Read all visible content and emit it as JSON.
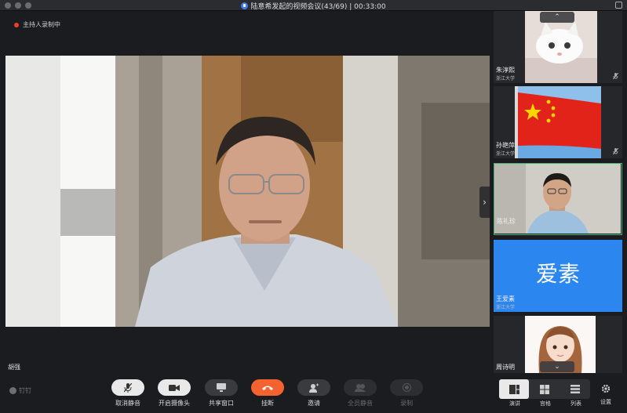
{
  "window": {
    "title": "陆意希发起的视频会议(43/69) | 00:33:00"
  },
  "main": {
    "recording_label": "主持人录制中",
    "speaker_name": "胡强"
  },
  "side": {
    "tiles": [
      {
        "name": "朱淳熙",
        "org": "浙江大学"
      },
      {
        "name": "孙艳萍",
        "org": "浙江大学"
      },
      {
        "name": "陈礼珍",
        "org": ""
      },
      {
        "name": "王爱素",
        "org": "浙江大学",
        "avatar_text": "爱素"
      },
      {
        "name": "周诗明",
        "org": ""
      }
    ]
  },
  "toolbar": {
    "brand": "钉钉",
    "buttons": [
      {
        "label": "取消静音",
        "icon": "mic-muted-icon"
      },
      {
        "label": "开启摄像头",
        "icon": "camera-icon"
      },
      {
        "label": "共享窗口",
        "icon": "share-screen-icon"
      },
      {
        "label": "挂断",
        "icon": "hangup-icon"
      },
      {
        "label": "邀请",
        "icon": "invite-icon"
      },
      {
        "label": "全员静音",
        "icon": "mute-all-icon"
      },
      {
        "label": "录制",
        "icon": "record-icon"
      }
    ],
    "views": [
      {
        "label": "演讲",
        "icon": "speaker-view-icon"
      },
      {
        "label": "宫格",
        "icon": "grid-view-icon"
      },
      {
        "label": "列表",
        "icon": "list-view-icon"
      }
    ],
    "settings_label": "设置"
  },
  "colors": {
    "accent_red": "#f4622f",
    "active_border": "#3fb571",
    "avatar_blue": "#2b87ef"
  }
}
